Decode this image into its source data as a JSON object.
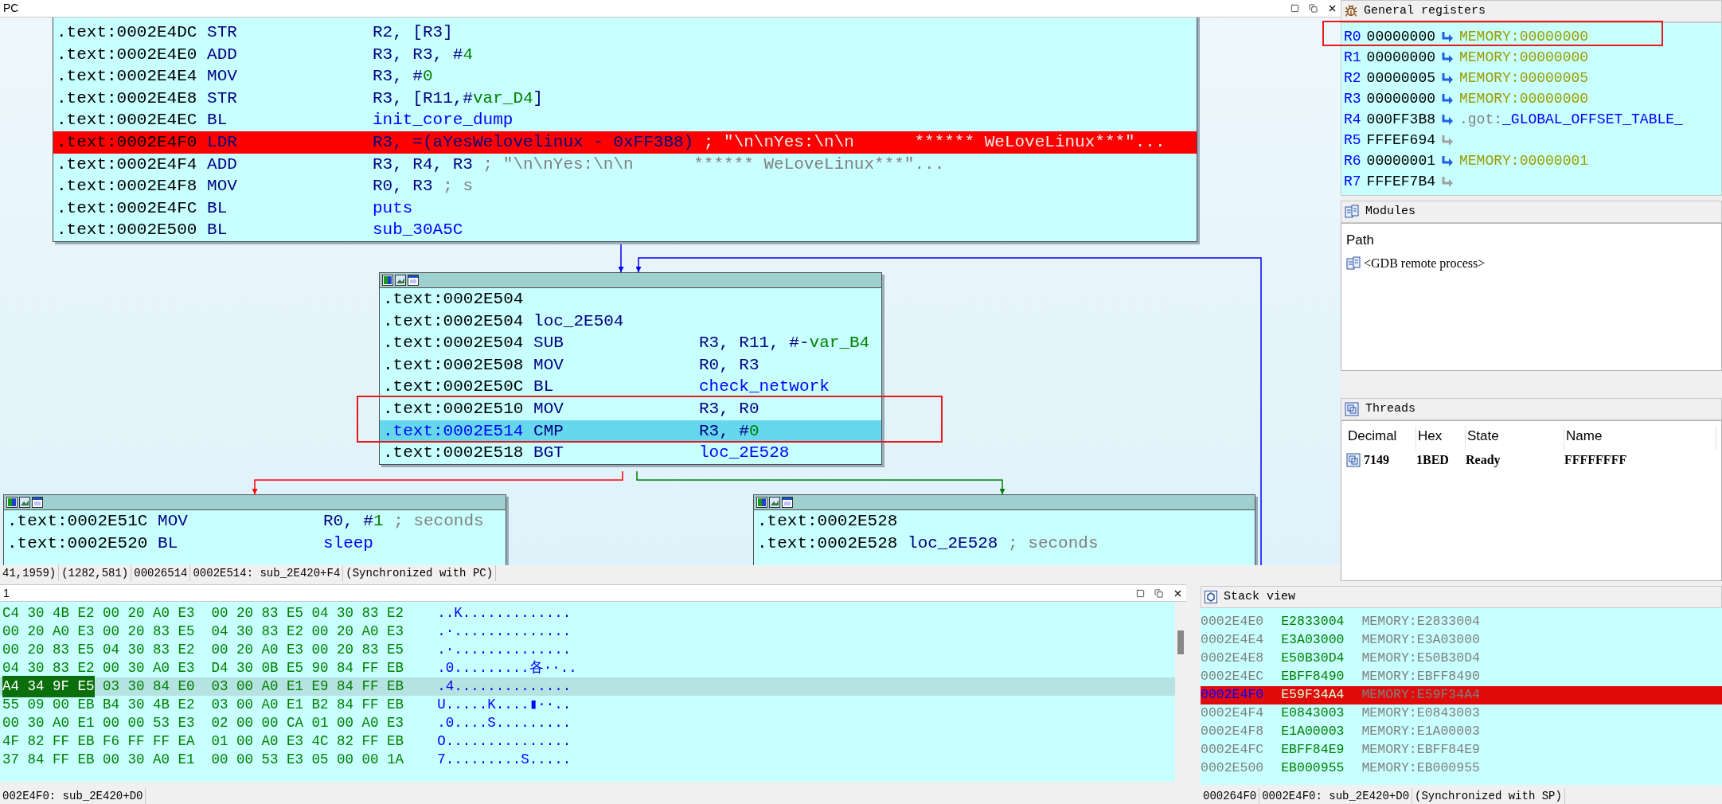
{
  "graph_view": {
    "title": "PC",
    "nodes": [
      {
        "header": false,
        "lines": [
          {
            "addr": ".text:0002E4DC",
            "mnem": "STR",
            "ops": [
              {
                "t": "R2, [R3]",
                "kind": "op"
              }
            ],
            "breakpoint": false,
            "selected": false
          },
          {
            "addr": ".text:0002E4E0",
            "mnem": "ADD",
            "ops": [
              {
                "t": "R3, R3, #",
                "kind": "op"
              },
              {
                "t": "4",
                "kind": "num"
              }
            ],
            "breakpoint": false,
            "selected": false
          },
          {
            "addr": ".text:0002E4E4",
            "mnem": "MOV",
            "ops": [
              {
                "t": "R3, #",
                "kind": "op"
              },
              {
                "t": "0",
                "kind": "num"
              }
            ],
            "breakpoint": false,
            "selected": false
          },
          {
            "addr": ".text:0002E4E8",
            "mnem": "STR",
            "ops": [
              {
                "t": "R3, [R11,#",
                "kind": "op"
              },
              {
                "t": "var_D4",
                "kind": "var"
              },
              {
                "t": "]",
                "kind": "op"
              }
            ],
            "breakpoint": false,
            "selected": false
          },
          {
            "addr": ".text:0002E4EC",
            "mnem": "BL",
            "ops": [
              {
                "t": "init_core_dump",
                "kind": "sym"
              }
            ],
            "breakpoint": false,
            "selected": false
          },
          {
            "addr": ".text:0002E4F0",
            "mnem": "LDR",
            "ops": [
              {
                "t": "R3, =(aYesWelovelinux - 0xFF3B8)",
                "kind": "op"
              }
            ],
            "comment": "; \"\\n\\nYes:\\n\\n      ****** WeLoveLinux***\"...",
            "breakpoint": true,
            "selected": false
          },
          {
            "addr": ".text:0002E4F4",
            "mnem": "ADD",
            "ops": [
              {
                "t": "R3, R4, R3",
                "kind": "op"
              }
            ],
            "comment": "; \"\\n\\nYes:\\n\\n      ****** WeLoveLinux***\"...",
            "breakpoint": false,
            "selected": false
          },
          {
            "addr": ".text:0002E4F8",
            "mnem": "MOV",
            "ops": [
              {
                "t": "R0, R3",
                "kind": "op"
              }
            ],
            "comment": "; s",
            "breakpoint": false,
            "selected": false
          },
          {
            "addr": ".text:0002E4FC",
            "mnem": "BL",
            "ops": [
              {
                "t": "puts",
                "kind": "sym"
              }
            ],
            "breakpoint": false,
            "selected": false
          },
          {
            "addr": ".text:0002E500",
            "mnem": "BL",
            "ops": [
              {
                "t": "sub_30A5C",
                "kind": "sym"
              }
            ],
            "breakpoint": false,
            "selected": false
          }
        ]
      },
      {
        "header": true,
        "lines": [
          {
            "addr": ".text:0002E504",
            "breakpoint": false,
            "selected": false
          },
          {
            "addr": ".text:0002E504",
            "ops": [
              {
                "t": "loc_2E504",
                "kind": "op"
              }
            ],
            "breakpoint": false,
            "selected": false
          },
          {
            "addr": ".text:0002E504",
            "mnem": "SUB",
            "ops": [
              {
                "t": "R3, R11, #-",
                "kind": "op"
              },
              {
                "t": "var_B4",
                "kind": "var"
              }
            ],
            "breakpoint": false,
            "selected": false
          },
          {
            "addr": ".text:0002E508",
            "mnem": "MOV",
            "ops": [
              {
                "t": "R0, R3",
                "kind": "op"
              }
            ],
            "breakpoint": false,
            "selected": false
          },
          {
            "addr": ".text:0002E50C",
            "mnem": "BL",
            "ops": [
              {
                "t": "check_network",
                "kind": "sym"
              }
            ],
            "breakpoint": false,
            "selected": false
          },
          {
            "addr": ".text:0002E510",
            "mnem": "MOV",
            "ops": [
              {
                "t": "R3, R0",
                "kind": "op"
              }
            ],
            "breakpoint": false,
            "selected": false
          },
          {
            "addr": ".text:0002E514",
            "mnem": "CMP",
            "ops": [
              {
                "t": "R3, #",
                "kind": "op"
              },
              {
                "t": "0",
                "kind": "num"
              }
            ],
            "breakpoint": false,
            "selected": true
          },
          {
            "addr": ".text:0002E518",
            "mnem": "BGT",
            "ops": [
              {
                "t": "loc_2E528",
                "kind": "sym"
              }
            ],
            "breakpoint": false,
            "selected": false
          }
        ]
      },
      {
        "header": true,
        "lines": [
          {
            "addr": ".text:0002E51C",
            "mnem": "MOV",
            "ops": [
              {
                "t": "R0, #",
                "kind": "op"
              },
              {
                "t": "1",
                "kind": "num"
              }
            ],
            "comment": "; seconds",
            "breakpoint": false,
            "selected": false
          },
          {
            "addr": ".text:0002E520",
            "mnem": "BL",
            "ops": [
              {
                "t": "sleep",
                "kind": "sym"
              }
            ],
            "breakpoint": false,
            "selected": false
          }
        ]
      },
      {
        "header": true,
        "lines": [
          {
            "addr": ".text:0002E528",
            "breakpoint": false,
            "selected": false
          },
          {
            "addr": ".text:0002E528",
            "ops": [
              {
                "t": "loc_2E528",
                "kind": "op"
              }
            ],
            "comment": "; seconds",
            "breakpoint": false,
            "selected": false
          }
        ]
      }
    ],
    "status_bar": [
      "41,1959)",
      "(1282,581)",
      "00026514",
      "0002E514: sub_2E420+F4",
      "(Synchronized with PC)"
    ]
  },
  "registers": {
    "title": "General registers",
    "rows": [
      {
        "name": "R0",
        "value": "00000000",
        "pointer": true,
        "target": [
          {
            "t": "MEMORY:00000000",
            "kind": "mem"
          }
        ]
      },
      {
        "name": "R1",
        "value": "00000000",
        "pointer": true,
        "target": [
          {
            "t": "MEMORY:00000000",
            "kind": "mem"
          }
        ]
      },
      {
        "name": "R2",
        "value": "00000005",
        "pointer": true,
        "target": [
          {
            "t": "MEMORY:00000005",
            "kind": "mem"
          }
        ]
      },
      {
        "name": "R3",
        "value": "00000000",
        "pointer": true,
        "target": [
          {
            "t": "MEMORY:00000000",
            "kind": "mem"
          }
        ]
      },
      {
        "name": "R4",
        "value": "000FF3B8",
        "pointer": true,
        "target": [
          {
            "t": ".got:",
            "kind": "seg"
          },
          {
            "t": "_GLOBAL_OFFSET_TABLE_",
            "kind": "sym"
          }
        ]
      },
      {
        "name": "R5",
        "value": "FFFEF694",
        "pointer": false
      },
      {
        "name": "R6",
        "value": "00000001",
        "pointer": true,
        "target": [
          {
            "t": "MEMORY:00000001",
            "kind": "mem"
          }
        ]
      },
      {
        "name": "R7",
        "value": "FFFEF7B4",
        "pointer": false
      }
    ]
  },
  "modules": {
    "title": "Modules",
    "columns": [
      "Path"
    ],
    "rows": [
      "<GDB remote process>"
    ]
  },
  "threads": {
    "title": "Threads",
    "columns": [
      "Decimal",
      "Hex",
      "State",
      "Name"
    ],
    "rows": [
      [
        "7149",
        "1BED",
        "Ready",
        "FFFFFFFF"
      ]
    ]
  },
  "hex_view": {
    "title": "1",
    "rows": [
      {
        "selected": false,
        "groups": [
          {
            "bytes": "C4 30 4B E2",
            "marked": false
          },
          {
            "bytes": "00 20 A0 E3",
            "marked": false
          },
          {
            "bytes": "00 20 83 E5",
            "marked": false
          },
          {
            "bytes": "04 30 83 E2",
            "marked": false
          }
        ],
        "ascii": "..K............."
      },
      {
        "selected": false,
        "groups": [
          {
            "bytes": "00 20 A0 E3",
            "marked": false
          },
          {
            "bytes": "00 20 83 E5",
            "marked": false
          },
          {
            "bytes": "04 30 83 E2",
            "marked": false
          },
          {
            "bytes": "00 20 A0 E3",
            "marked": false
          }
        ],
        "ascii": ".·.............."
      },
      {
        "selected": false,
        "groups": [
          {
            "bytes": "00 20 83 E5",
            "marked": false
          },
          {
            "bytes": "04 30 83 E2",
            "marked": false
          },
          {
            "bytes": "00 20 A0 E3",
            "marked": false
          },
          {
            "bytes": "00 20 83 E5",
            "marked": false
          }
        ],
        "ascii": ".·.............."
      },
      {
        "selected": false,
        "groups": [
          {
            "bytes": "04 30 83 E2",
            "marked": false
          },
          {
            "bytes": "00 30 A0 E3",
            "marked": false
          },
          {
            "bytes": "D4 30 0B E5",
            "marked": false
          },
          {
            "bytes": "90 84 FF EB",
            "marked": false
          }
        ],
        "ascii": ".0.........各··.."
      },
      {
        "selected": true,
        "groups": [
          {
            "bytes": "A4 34 9F E5",
            "marked": true
          },
          {
            "bytes": "03 30 84 E0",
            "marked": false
          },
          {
            "bytes": "03 00 A0 E1",
            "marked": false
          },
          {
            "bytes": "E9 84 FF EB",
            "marked": false
          }
        ],
        "ascii": ".4.............."
      },
      {
        "selected": false,
        "groups": [
          {
            "bytes": "55 09 00 EB",
            "marked": false
          },
          {
            "bytes": "B4 30 4B E2",
            "marked": false
          },
          {
            "bytes": "03 00 A0 E1",
            "marked": false
          },
          {
            "bytes": "B2 84 FF EB",
            "marked": false
          }
        ],
        "ascii": "U.....K....▮··.."
      },
      {
        "selected": false,
        "groups": [
          {
            "bytes": "00 30 A0 E1",
            "marked": false
          },
          {
            "bytes": "00 00 53 E3",
            "marked": false
          },
          {
            "bytes": "02 00 00 CA",
            "marked": false
          },
          {
            "bytes": "01 00 A0 E3",
            "marked": false
          }
        ],
        "ascii": ".0....S........."
      },
      {
        "selected": false,
        "groups": [
          {
            "bytes": "4F 82 FF EB",
            "marked": false
          },
          {
            "bytes": "F6 FF FF EA",
            "marked": false
          },
          {
            "bytes": "01 00 A0 E3",
            "marked": false
          },
          {
            "bytes": "4C 82 FF EB",
            "marked": false
          }
        ],
        "ascii": "O..............."
      },
      {
        "selected": false,
        "groups": [
          {
            "bytes": "37 84 FF EB",
            "marked": false
          },
          {
            "bytes": "00 30 A0 E1",
            "marked": false
          },
          {
            "bytes": "00 00 53 E3",
            "marked": false
          },
          {
            "bytes": "05 00 00 1A",
            "marked": false
          }
        ],
        "ascii": "7.........S....."
      }
    ],
    "status_bar": [
      "002E4F0: sub_2E420+D0"
    ]
  },
  "stack_view": {
    "title": "Stack view",
    "rows": [
      {
        "addr": "0002E4E0",
        "value": "E2833004",
        "target": "MEMORY:E2833004",
        "selected": false
      },
      {
        "addr": "0002E4E4",
        "value": "E3A03000",
        "target": "MEMORY:E3A03000",
        "selected": false
      },
      {
        "addr": "0002E4E8",
        "value": "E50B30D4",
        "target": "MEMORY:E50B30D4",
        "selected": false
      },
      {
        "addr": "0002E4EC",
        "value": "EBFF8490",
        "target": "MEMORY:EBFF8490",
        "selected": false
      },
      {
        "addr": "0002E4F0",
        "value": "E59F34A4",
        "target": "MEMORY:E59F34A4",
        "selected": true
      },
      {
        "addr": "0002E4F4",
        "value": "E0843003",
        "target": "MEMORY:E0843003",
        "selected": false
      },
      {
        "addr": "0002E4F8",
        "value": "E1A00003",
        "target": "MEMORY:E1A00003",
        "selected": false
      },
      {
        "addr": "0002E4FC",
        "value": "EBFF84E9",
        "target": "MEMORY:EBFF84E9",
        "selected": false
      },
      {
        "addr": "0002E500",
        "value": "EB000955",
        "target": "MEMORY:EB000955",
        "selected": false
      }
    ],
    "status_bar": [
      "000264F0",
      "0002E4F0: sub_2E420+D0",
      "(Synchronized with SP)"
    ]
  }
}
